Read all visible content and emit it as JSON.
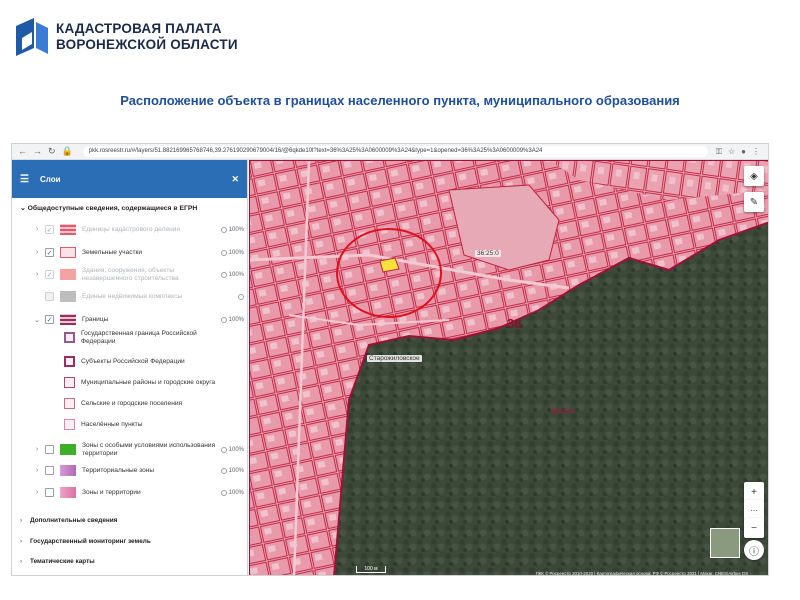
{
  "header": {
    "org_line1": "КАДАСТРОВАЯ ПАЛАТА",
    "org_line2": "ВОРОНЕЖСКОЙ ОБЛАСТИ",
    "slide_title": "Расположение объекта в границах населенного пункта, муниципального образования"
  },
  "browser": {
    "url": "pkk.rosreestr.ru/#/layers/51.882169965768746,39.276190290679004/16/@6qkde10l?text=36%3A25%3A0600009%3A24&type=1&opened=36%3A25%3A0600009%3A24"
  },
  "sidebar": {
    "title": "Слои",
    "section_title": "Общедоступные сведения, содержащиеся в ЕГРН",
    "layers": [
      {
        "label": "Единицы кадастрового деления",
        "pct": "100%",
        "color": "#e35a6a"
      },
      {
        "label": "Земельные участки",
        "pct": "100%",
        "color": "#e35a6a"
      },
      {
        "label": "Здания, сооружения, объекты незавершенного строительства",
        "pct": "100%",
        "color": "#e98a8a"
      },
      {
        "label": "Единые недвижимые комплексы",
        "pct": "",
        "color": "#b9b9b9"
      },
      {
        "label": "Границы",
        "pct": "100%",
        "color": "#9b2e5f"
      }
    ],
    "border_sublayers": [
      {
        "label": "Государственная граница Российской Федерации"
      },
      {
        "label": "Субъекты Российской Федерации"
      },
      {
        "label": "Муниципальные районы и городские округа"
      },
      {
        "label": "Сельские и городские поселения"
      },
      {
        "label": "Населённые пункты"
      }
    ],
    "zone_layers": [
      {
        "label": "Зоны с особыми условиями использования территории",
        "pct": "100%",
        "color": "#3fae2a"
      },
      {
        "label": "Территориальные зоны",
        "pct": "100%",
        "color": "#c47fc4"
      },
      {
        "label": "Зоны и территории",
        "pct": "100%",
        "color": "#e07ab0"
      }
    ],
    "bottom_sections": [
      "Дополнительные сведения",
      "Государственный мониторинг земель",
      "Тематические карты"
    ]
  },
  "map": {
    "label_settlement": "Старожиловское",
    "label_36": "36",
    "label_zone": "36:25:0",
    "label_zone2": "36:25:0",
    "scale": "100 м",
    "attribution": "ПКК © Росреестр 2010-2020 | Картографическая основа: РФ © Росреестр 2021 | Maxar, CNES/Airbus DS"
  }
}
